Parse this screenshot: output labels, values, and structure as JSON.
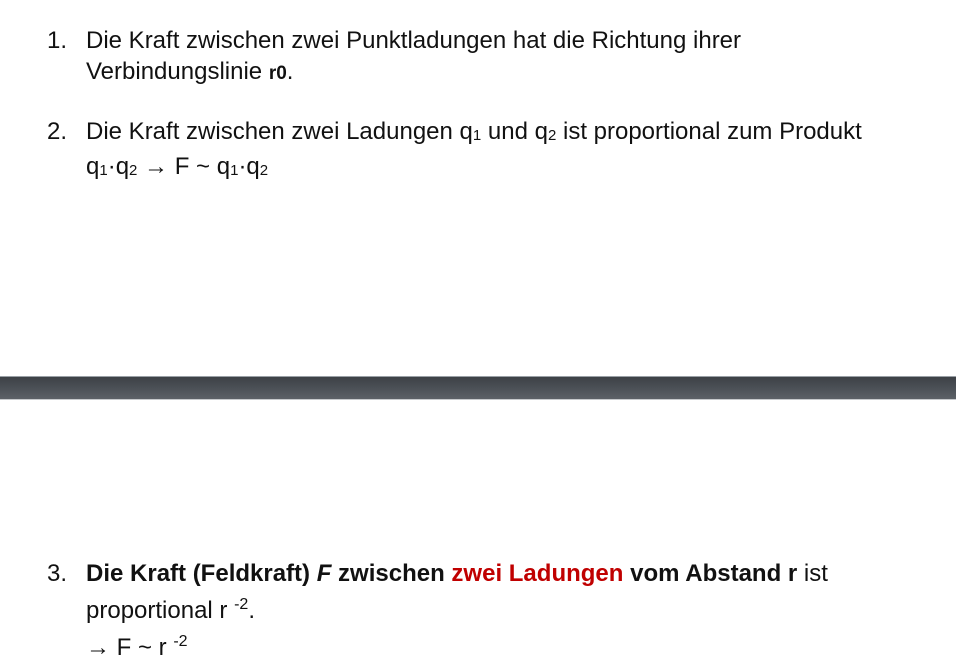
{
  "items": [
    {
      "number": "1.",
      "line1": "Die Kraft zwischen zwei Punktladungen hat die Richtung ihrer",
      "line2_text": "Verbindungslinie ",
      "line2_r": "r",
      "line2_sub": "0",
      "line2_end": "."
    },
    {
      "number": "2.",
      "line1_a": "Die Kraft zwischen zwei Ladungen q",
      "line1_sub1": "1",
      "line1_b": " und q",
      "line1_sub2": "2",
      "line1_c": " ist proportional zum Produkt",
      "line2_q1": "q",
      "line2_s1": "1",
      "line2_dot1": "·q",
      "line2_s2": "2",
      "line2_arrow": " → F ~ q",
      "line2_s3": "1",
      "line2_dot2": "·q",
      "line2_s4": "2"
    },
    {
      "number": "3.",
      "bold_a": "Die Kraft (Feldkraft) ",
      "italic_f": "F",
      "bold_b": " zwischen ",
      "red": "zwei Ladungen",
      "bold_c": " vom Abstand r",
      "normal_a": " ist",
      "line2_text": "proportional r ",
      "line2_sup": "-2",
      "line2_end": ".",
      "line3_text": "→ F ~ r ",
      "line3_sup": "-2"
    }
  ]
}
